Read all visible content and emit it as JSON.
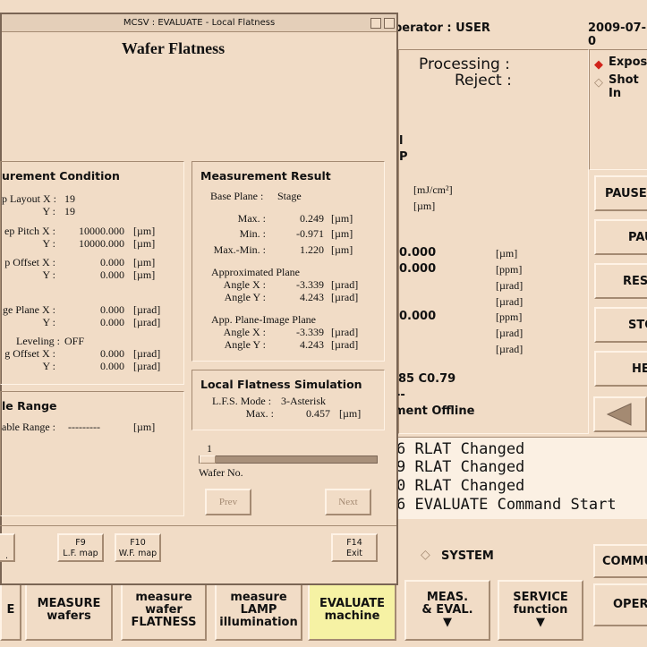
{
  "background": {
    "operator": "perator : USER",
    "date": "2009-07-0",
    "processing_label": "Processing :",
    "reject_label": "Reject :",
    "radio_exposure": "Exposu",
    "radio_shot": "Shot In",
    "partial_l": "l",
    "partial_p": "P",
    "unit_mj": "[mJ/cm²]",
    "unit_um": "[µm]",
    "values": {
      "v1": "0.000",
      "v2": "0.000",
      "v3": "0.000"
    },
    "units_col": [
      "[µm]",
      "[ppm]",
      "[µrad]",
      "[µrad]",
      "[ppm]",
      "[µrad]",
      "[µrad]"
    ],
    "partial_c": ".85 C0.79",
    "partial_dashes": "--",
    "offline": "ment Offline",
    "side_buttons": [
      "PAUSE",
      "PAU",
      "RESU",
      "STO",
      "HE"
    ],
    "log_lines": [
      "6 RLAT Changed",
      "9 RLAT Changed",
      "0 RLAT Changed",
      "6 EVALUATE Command Start"
    ],
    "system_label": "SYSTEM",
    "commu": "COMMU",
    "oper": "OPER",
    "bottom_buttons": [
      {
        "l1": "E",
        "l2": ""
      },
      {
        "l1": "MEASURE",
        "l2": "wafers"
      },
      {
        "l1": "measure",
        "l2": "wafer",
        "l3": "FLATNESS"
      },
      {
        "l1": "measure",
        "l2": "LAMP",
        "l3": "illumination"
      },
      {
        "l1": "EVALUATE",
        "l2": "machine"
      },
      {
        "l1": "MEAS.",
        "l2": "& EVAL.",
        "l3": "▼"
      },
      {
        "l1": "SERVICE",
        "l2": "function",
        "l3": "▼"
      }
    ]
  },
  "window": {
    "title": "MCSV : EVALUATE - Local Flatness",
    "heading": "Wafer Flatness",
    "condition": {
      "title": "urement Condition",
      "rows": [
        {
          "label": "p Layout X :",
          "value": "19",
          "unit": ""
        },
        {
          "label": "Y :",
          "value": "19",
          "unit": ""
        },
        {
          "label": "ep Pitch X :",
          "value": "10000.000",
          "unit": "[µm]"
        },
        {
          "label": "Y :",
          "value": "10000.000",
          "unit": "[µm]"
        },
        {
          "label": "p Offset X :",
          "value": "0.000",
          "unit": "[µm]"
        },
        {
          "label": "Y :",
          "value": "0.000",
          "unit": "[µm]"
        },
        {
          "label": "ge Plane X :",
          "value": "0.000",
          "unit": "[µrad]"
        },
        {
          "label": "Y :",
          "value": "0.000",
          "unit": "[µrad]"
        },
        {
          "label": "Leveling :",
          "value": "OFF",
          "unit": ""
        },
        {
          "label": "g Offset X :",
          "value": "0.000",
          "unit": "[µrad]"
        },
        {
          "label": "Y :",
          "value": "0.000",
          "unit": "[µrad]"
        }
      ]
    },
    "range": {
      "title": "le Range",
      "label": "able Range :",
      "value": "---------",
      "unit": "[µm]"
    },
    "result": {
      "title": "Measurement Result",
      "base_plane_label": "Base Plane :",
      "base_plane_value": "Stage",
      "max_label": "Max. :",
      "max_value": "0.249",
      "max_unit": "[µm]",
      "min_label": "Min. :",
      "min_value": "-0.971",
      "min_unit": "[µm]",
      "maxmin_label": "Max.-Min. :",
      "maxmin_value": "1.220",
      "maxmin_unit": "[µm]",
      "approx_title": "Approximated Plane",
      "approx_ax_label": "Angle X :",
      "approx_ax_value": "-3.339",
      "approx_ax_unit": "[µrad]",
      "approx_ay_label": "Angle Y :",
      "approx_ay_value": "4.243",
      "approx_ay_unit": "[µrad]",
      "app_image_title": "App. Plane-Image Plane",
      "ai_ax_label": "Angle X :",
      "ai_ax_value": "-3.339",
      "ai_ax_unit": "[µrad]",
      "ai_ay_label": "Angle Y :",
      "ai_ay_value": "4.243",
      "ai_ay_unit": "[µrad]"
    },
    "simulation": {
      "title": "Local Flatness Simulation",
      "mode_label": "L.F.S. Mode :",
      "mode_value": "3-Asterisk",
      "max_label": "Max. :",
      "max_value": "0.457",
      "max_unit": "[µm]"
    },
    "wafer": {
      "number": "1",
      "label": "Wafer No.",
      "slider_fraction": 0.0,
      "prev": "Prev",
      "next": "Next"
    },
    "fkeys": {
      "partial": ".",
      "f9_top": "F9",
      "f9_bottom": "L.F. map",
      "f10_top": "F10",
      "f10_bottom": "W.F. map",
      "f14_top": "F14",
      "f14_bottom": "Exit"
    }
  }
}
